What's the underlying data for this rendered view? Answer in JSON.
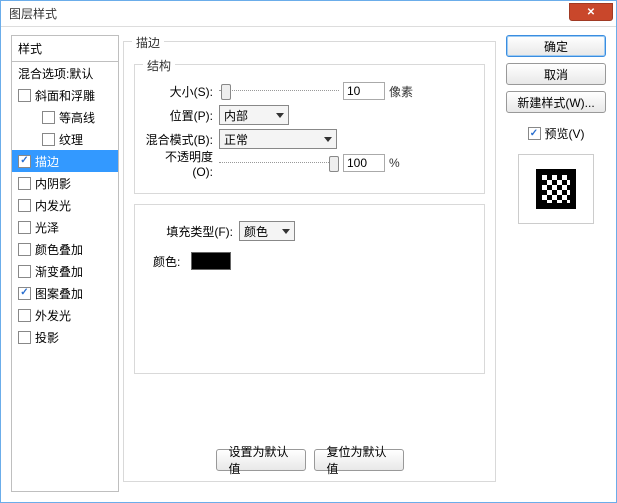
{
  "title": "图层样式",
  "left": {
    "header": "样式",
    "blend": "混合选项:默认",
    "items": [
      {
        "label": "斜面和浮雕",
        "checked": false
      },
      {
        "label": "等高线",
        "checked": false,
        "indent": true
      },
      {
        "label": "纹理",
        "checked": false,
        "indent": true
      },
      {
        "label": "描边",
        "checked": true,
        "selected": true
      },
      {
        "label": "内阴影",
        "checked": false
      },
      {
        "label": "内发光",
        "checked": false
      },
      {
        "label": "光泽",
        "checked": false
      },
      {
        "label": "颜色叠加",
        "checked": false
      },
      {
        "label": "渐变叠加",
        "checked": false
      },
      {
        "label": "图案叠加",
        "checked": true
      },
      {
        "label": "外发光",
        "checked": false
      },
      {
        "label": "投影",
        "checked": false
      }
    ]
  },
  "main": {
    "strokeLegend": "描边",
    "structLegend": "结构",
    "sizeLabel": "大小(S):",
    "sizeValue": "10",
    "sizeUnit": "像素",
    "posLabel": "位置(P):",
    "posValue": "内部",
    "blendLabel": "混合模式(B):",
    "blendValue": "正常",
    "opacityLabel": "不透明度(O):",
    "opacityValue": "100",
    "opacityUnit": "%",
    "fillTypeLabel": "填充类型(F):",
    "fillTypeValue": "颜色",
    "colorLabel": "颜色:",
    "defaultBtn": "设置为默认值",
    "resetBtn": "复位为默认值"
  },
  "right": {
    "ok": "确定",
    "cancel": "取消",
    "newStyle": "新建样式(W)...",
    "previewCheck": "预览(V)"
  }
}
